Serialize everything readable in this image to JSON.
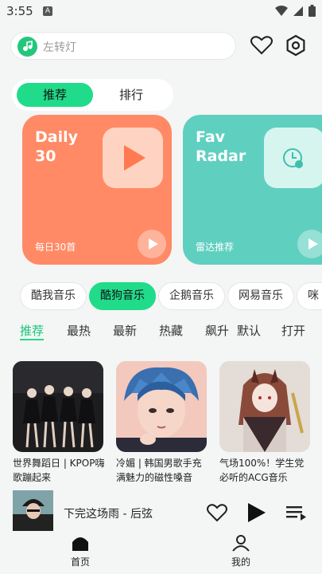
{
  "status_bar": {
    "time": "3:55",
    "notification": "A"
  },
  "search": {
    "placeholder": "左转灯"
  },
  "tabs": [
    {
      "label": "推荐",
      "active": true
    },
    {
      "label": "排行",
      "active": false
    }
  ],
  "cards": [
    {
      "title_line1": "Daily",
      "title_line2": "30",
      "subtitle": "每日30首",
      "color": "#ff8a65"
    },
    {
      "title_line1": "Fav",
      "title_line2": "Radar",
      "subtitle": "雷达推荐",
      "color": "#5fcfc0"
    }
  ],
  "sources": [
    {
      "label": "酷我音乐",
      "active": false
    },
    {
      "label": "酷狗音乐",
      "active": true
    },
    {
      "label": "企鹅音乐",
      "active": false
    },
    {
      "label": "网易音乐",
      "active": false
    },
    {
      "label": "咪",
      "active": false
    }
  ],
  "categories": [
    {
      "label": "推荐",
      "active": true
    },
    {
      "label": "最热",
      "active": false
    },
    {
      "label": "最新",
      "active": false
    },
    {
      "label": "热藏",
      "active": false
    },
    {
      "label": "飙升",
      "active": false
    },
    {
      "label": "默认",
      "active": false
    },
    {
      "label": "打开",
      "active": false
    }
  ],
  "playlists": [
    {
      "title": "世界舞蹈日 | KPOP嗨歌蹦起来"
    },
    {
      "title": "冷媚 | 韩国男歌手充满魅力的磁性嗓音"
    },
    {
      "title": "气场100%！学生党必听的ACG音乐"
    }
  ],
  "player": {
    "song": "下完这场雨 - 后弦"
  },
  "nav": [
    {
      "label": "首页",
      "active": true
    },
    {
      "label": "我的",
      "active": false
    }
  ],
  "colors": {
    "accent": "#20dc8a",
    "card_orange": "#ff8a65",
    "card_teal": "#5fcfc0"
  }
}
